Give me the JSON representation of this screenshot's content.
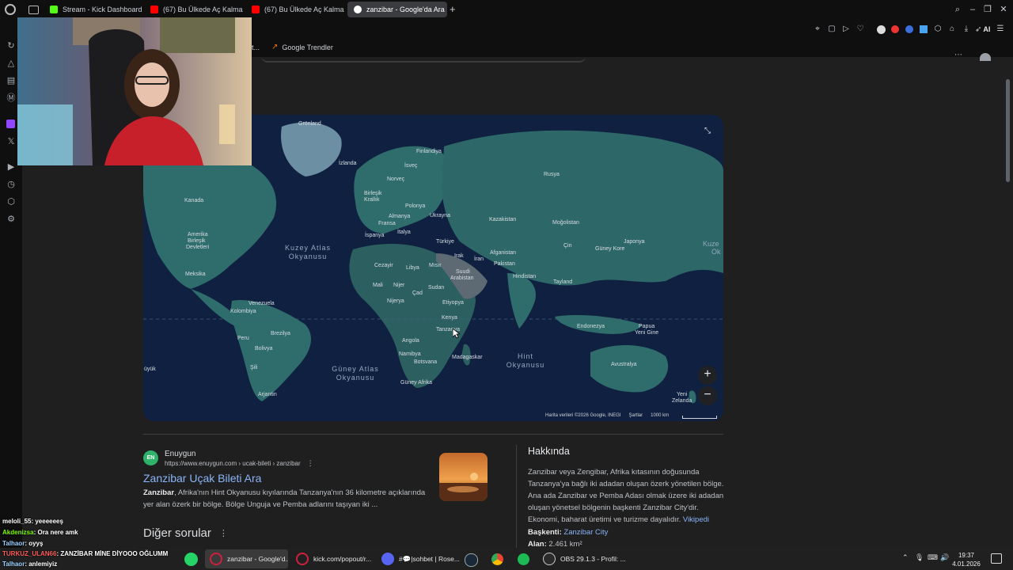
{
  "browser": {
    "tabs": [
      {
        "label": "Stream - Kick Dashboard",
        "color": "#53fc18"
      },
      {
        "label": "(67) Bu Ülkede Aç Kalmaz",
        "color": "#ff0000"
      },
      {
        "label": "(67) Bu Ülkede Aç Kalmaz",
        "color": "#ff0000"
      },
      {
        "label": "zanzibar - Google'da Ara",
        "color": "#4285f4"
      }
    ],
    "new_tab": "+",
    "bookmark_partial": "t...",
    "bookmark": "Google Trendler",
    "ai_label": "AI"
  },
  "map": {
    "labels": {
      "gronland": "Grönland",
      "finlandiya": "Finlandiya",
      "izlanda": "İzlanda",
      "isvec": "İsveç",
      "norvec": "Norveç",
      "rusya": "Rusya",
      "birlesik": "Birleşik",
      "krallik": "Krallık",
      "polonya": "Polonya",
      "ukrayna": "Ukrayna",
      "kanada": "Kanada",
      "almanya": "Almanya",
      "kazakistan": "Kazakistan",
      "mogolistan": "Moğolistan",
      "fransa": "Fransa",
      "italya": "İtalya",
      "ispanya": "İspanya",
      "turkiye": "Türkiye",
      "abd1": "Amerika",
      "abd2": "Birleşik",
      "abd3": "Devletleri",
      "japonya": "Japonya",
      "cin": "Çin",
      "guneykore": "Güney Kore",
      "irak": "Irak",
      "afganistan": "Afganistan",
      "iran": "İran",
      "pakistan": "Pakistan",
      "cezayir": "Cezayir",
      "libya": "Libya",
      "misir": "Mısır",
      "suudi1": "Suudi",
      "suudi2": "Arabistan",
      "meksika": "Meksika",
      "hindistan": "Hindistan",
      "tayland": "Tayland",
      "mali": "Mali",
      "nijer": "Nijer",
      "cad": "Çad",
      "sudan": "Sudan",
      "nijerya": "Nijerya",
      "etiyopya": "Etiyopya",
      "venezuela": "Venezuela",
      "kolombiya": "Kolombiya",
      "kenya": "Kenya",
      "endonezya": "Endonezya",
      "papua1": "Papua",
      "papua2": "Yeni Gine",
      "tanzanya": "Tanzanya",
      "peru": "Peru",
      "brezilya": "Brezilya",
      "angola": "Angola",
      "bolivya": "Bolivya",
      "namibya": "Namibya",
      "botsvana": "Botsvana",
      "madagaskar": "Madagaskar",
      "avustralya": "Avustralya",
      "sili": "Şili",
      "guneyafrika": "Güney Afrika",
      "arjantin": "Arjantin",
      "yenizelanda1": "Yeni",
      "yenizelanda2": "Zelanda",
      "buyuk": "üyük",
      "kuze1": "Kuze",
      "kuze2": "Ok"
    },
    "oceans": {
      "kuzey_atlas": "Kuzey Atlas\nOkyanusu",
      "guney_atlas": "Güney Atlas\nOkyanusu",
      "hint": "Hint\nOkyanusu"
    },
    "attribution": "Harita verileri ©2026 Google, INEGI",
    "terms": "Şartlar",
    "scale": "1000 km",
    "zoom_in": "+",
    "zoom_out": "−"
  },
  "result": {
    "source_icon": "EN",
    "source": "Enuygun",
    "url": "https://www.enuygun.com › ucak-bileti › zanzibar",
    "more": "⋮",
    "title": "Zanzibar Uçak Bileti Ara",
    "snippet_bold": "Zanzibar",
    "snippet": ", Afrika'nın Hint Okyanusu kıyılarında Tanzanya'nın 36 kilometre açıklarında yer alan özerk bir bölge. Bölge Unguja ve Pemba adlarını taşıyan iki ..."
  },
  "other_questions": {
    "title": "Diğer sorular",
    "more": "⋮"
  },
  "about": {
    "title": "Hakkında",
    "text": "Zanzibar veya Zengibar, Afrika kıtasının doğusunda Tanzanya'ya bağlı iki adadan oluşan özerk yönetilen bölge. Ana ada Zanzibar ve Pemba Adası olmak üzere iki adadan oluşan yönetsel bölgenin başkenti Zanzibar City'dir. Ekonomi, baharat üretimi ve turizme dayalıdır.",
    "wiki": "Vikipedi",
    "capital_label": "Başkenti:",
    "capital_value": "Zanzibar City",
    "area_label": "Alan:",
    "area_value": "2.461 km²"
  },
  "chat": [
    {
      "user": "meloli_55",
      "msg": ": yeeeeeeş",
      "color": "#ffffff"
    },
    {
      "user": "Akdenizsa",
      "msg": ": Ora nere amk",
      "color": "#7CFC00"
    },
    {
      "user": "Talhaor",
      "msg": ": oyyş",
      "color": "#9ad0ff"
    },
    {
      "user": "TURKUZ_ULAN66",
      "msg": ": ZANZİBAR MİNE DİYOOO OĞLUMM",
      "color": "#ff5a5a"
    },
    {
      "user": "Talhaor",
      "msg": ": anlemiyiz",
      "color": "#9ad0ff"
    }
  ],
  "taskbar": {
    "items": [
      {
        "label": "zanzibar - Google'd...",
        "color": "#d02040"
      },
      {
        "label": "kick.com/popout/r...",
        "color": "#d02040"
      },
      {
        "label": "#💬|sohbet | Rose...",
        "color": "#5865f2"
      },
      {
        "label": "OBS 29.1.3 - Profil: ...",
        "color": "#444444"
      }
    ],
    "time": "19:37",
    "date": "4.01.2026"
  }
}
